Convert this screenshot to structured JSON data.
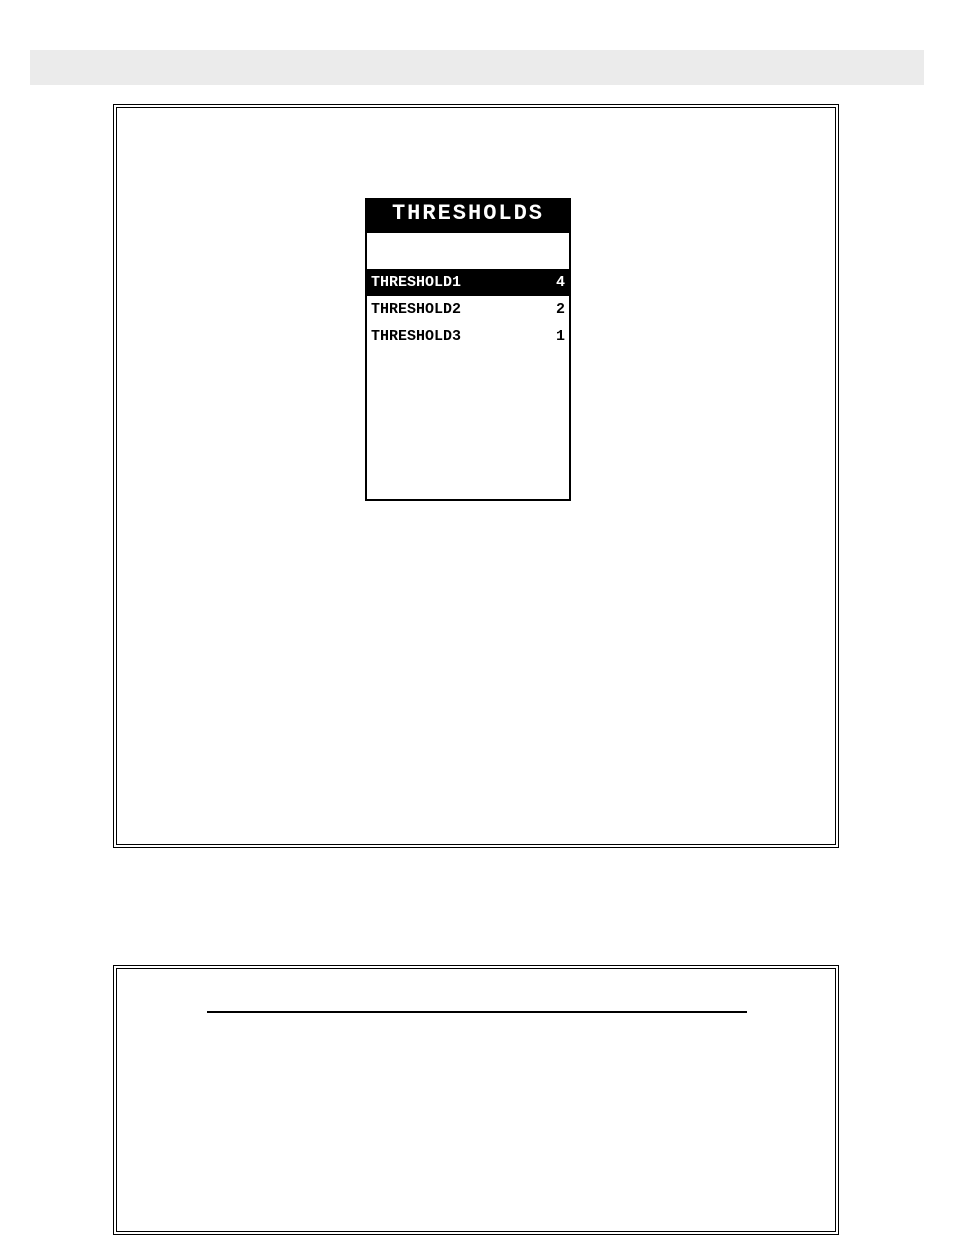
{
  "menu": {
    "title": "THRESHOLDS",
    "items": [
      {
        "label": "THRESHOLD1",
        "value": "4",
        "selected": true
      },
      {
        "label": "THRESHOLD2",
        "value": "2",
        "selected": false
      },
      {
        "label": "THRESHOLD3",
        "value": "1",
        "selected": false
      }
    ]
  }
}
